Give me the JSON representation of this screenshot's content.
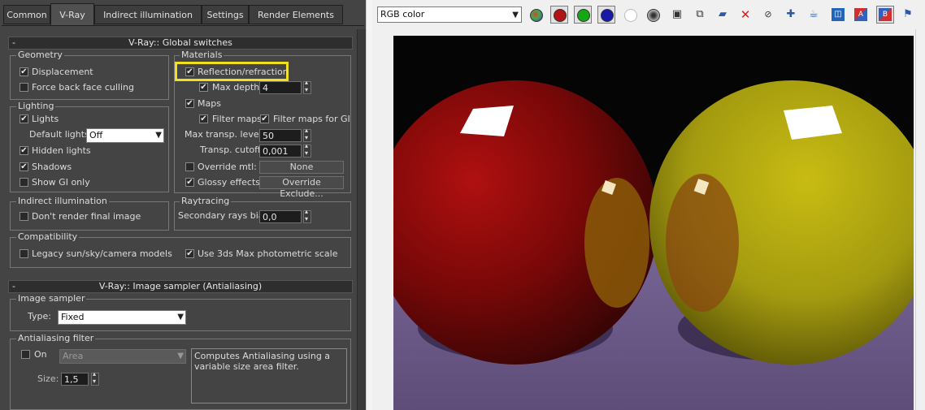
{
  "tabs": [
    "Common",
    "V-Ray",
    "Indirect illumination",
    "Settings",
    "Render Elements"
  ],
  "active_tab": "V-Ray",
  "global_switches": {
    "header": "V-Ray:: Global switches",
    "collapse_glyph": "-",
    "geometry": {
      "label": "Geometry",
      "displacement": "Displacement",
      "force_back_face_culling": "Force back face culling"
    },
    "lighting": {
      "label": "Lighting",
      "lights": "Lights",
      "default_lights_label": "Default lights",
      "default_lights_value": "Off",
      "hidden_lights": "Hidden lights",
      "shadows": "Shadows",
      "show_gi_only": "Show GI only"
    },
    "materials": {
      "label": "Materials",
      "reflection_refraction": "Reflection/refraction",
      "max_depth_label": "Max depth",
      "max_depth_value": "4",
      "maps": "Maps",
      "filter_maps": "Filter maps",
      "filter_maps_for_gi": "Filter maps for GI",
      "max_transp_levels_label": "Max transp. levels",
      "max_transp_levels_value": "50",
      "transp_cutoff_label": "Transp. cutoff",
      "transp_cutoff_value": "0,001",
      "override_mtl": "Override mtl:",
      "override_mtl_button": "None",
      "glossy_effects": "Glossy effects",
      "override_exclude_button": "Override Exclude..."
    },
    "indirect_illumination": {
      "label": "Indirect illumination",
      "dont_render_final_image": "Don't render final image"
    },
    "raytracing": {
      "label": "Raytracing",
      "secondary_rays_bias_label": "Secondary rays bias",
      "secondary_rays_bias_value": "0,0"
    },
    "compatibility": {
      "label": "Compatibility",
      "legacy_models": "Legacy sun/sky/camera models",
      "use_photometric_scale": "Use 3ds Max photometric scale"
    }
  },
  "image_sampler": {
    "header": "V-Ray:: Image sampler (Antialiasing)",
    "collapse_glyph": "-",
    "group_label": "Image sampler",
    "type_label": "Type:",
    "type_value": "Fixed",
    "aa_filter_label": "Antialiasing filter",
    "on_label": "On",
    "filter_value": "Area",
    "description": "Computes Antialiasing using a variable size area filter.",
    "size_label": "Size:",
    "size_value": "1,5"
  },
  "frame_buffer": {
    "channel_value": "RGB color"
  },
  "colors": {
    "panel_bg": "#444444",
    "highlight": "#f0e020",
    "red_sphere": "#8a0c0c",
    "yellow_sphere": "#b8a818",
    "floor": "#6d5b8a"
  }
}
